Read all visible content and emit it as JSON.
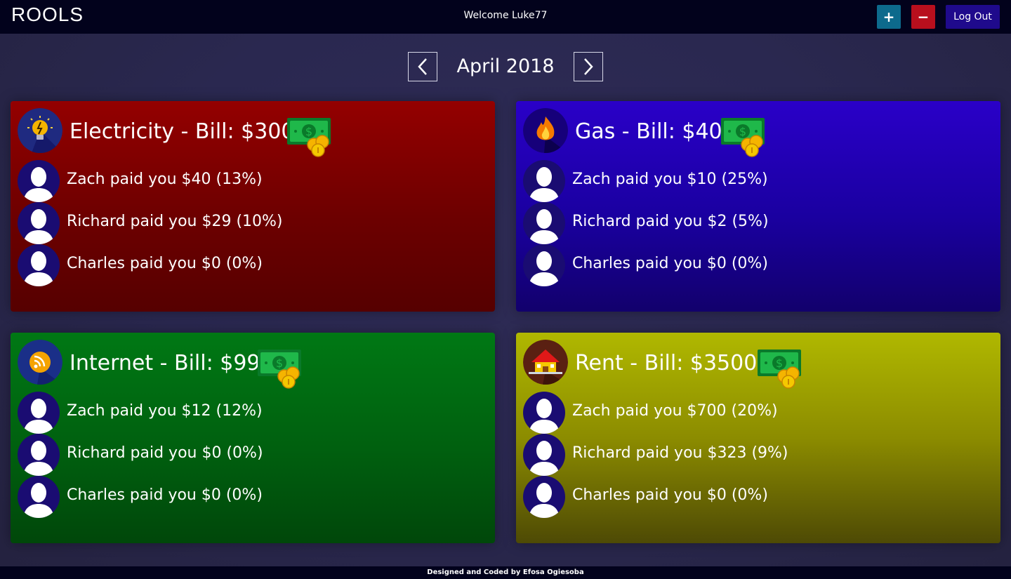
{
  "header": {
    "brand": "ROOLS",
    "welcome": "Welcome Luke77",
    "add_label": "+",
    "remove_label": "−",
    "logout_label": "Log Out"
  },
  "month_nav": {
    "label": "April 2018"
  },
  "bills": [
    {
      "title": "Electricity - Bill: $300",
      "icon": "lightbulb-icon",
      "color": "#940000",
      "payments": [
        {
          "text": "Zach paid you $40 (13%)"
        },
        {
          "text": "Richard paid you $29 (10%)"
        },
        {
          "text": "Charles paid you $0 (0%)"
        }
      ]
    },
    {
      "title": "Gas - Bill: $40",
      "icon": "flame-icon",
      "color": "#2a00c8",
      "payments": [
        {
          "text": "Zach paid you $10 (25%)"
        },
        {
          "text": "Richard paid you $2 (5%)"
        },
        {
          "text": "Charles paid you $0 (0%)"
        }
      ]
    },
    {
      "title": "Internet - Bill: $99",
      "icon": "wifi-icon",
      "color": "#007814",
      "payments": [
        {
          "text": "Zach paid you $12 (12%)"
        },
        {
          "text": "Richard paid you $0 (0%)"
        },
        {
          "text": "Charles paid you $0 (0%)"
        }
      ]
    },
    {
      "title": "Rent - Bill: $3500",
      "icon": "house-icon",
      "color": "#b0b800",
      "payments": [
        {
          "text": "Zach paid you $700 (20%)"
        },
        {
          "text": "Richard paid you $323 (9%)"
        },
        {
          "text": "Charles paid you $0 (0%)"
        }
      ]
    }
  ],
  "footer": {
    "text": "Designed and Coded by Efosa Ogiesoba"
  }
}
